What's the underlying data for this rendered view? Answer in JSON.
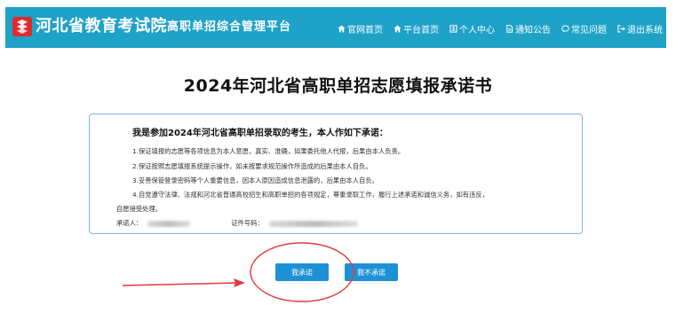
{
  "header": {
    "site_title": "河北省教育考试院",
    "platform_title": "高职单招综合管理平台",
    "nav": [
      {
        "label": "官网首页",
        "icon": "home-icon"
      },
      {
        "label": "平台首页",
        "icon": "home-icon"
      },
      {
        "label": "个人中心",
        "icon": "user-card-icon"
      },
      {
        "label": "通知公告",
        "icon": "document-icon"
      },
      {
        "label": "常见问题",
        "icon": "chat-bubble-icon"
      },
      {
        "label": "退出系统",
        "icon": "logout-icon"
      }
    ],
    "bar_color": "#1ea2c8"
  },
  "main": {
    "title": "2024年河北省高职单招志愿填报承诺书",
    "commitment": {
      "heading": "我是参加2024年河北省高职单招录取的考生，本人作如下承诺：",
      "clauses": [
        "1.保证填报的志愿等各项信息为本人意愿，真实、准确，如果委托他人代报，后果由本人负责。",
        "2.保证按照志愿填报系统提示操作，如未按要求规范操作所造成的后果由本人自负。",
        "3.妥善保管登录密码等个人重要信息，因本人原因造成信息泄露的，后果由本人自负。",
        "4.自觉遵守法律、法规和河北省普通高校招生和高职单招的各项规定，尊重录取工作，履行上述承诺和诚信义务，如有违反，",
        "自愿接受处理。"
      ],
      "signer_label": "承诺人：",
      "id_label": "证件号码："
    },
    "buttons": {
      "agree": "我承诺",
      "disagree": "我不承诺"
    },
    "accent_color": "#1e90d6"
  }
}
